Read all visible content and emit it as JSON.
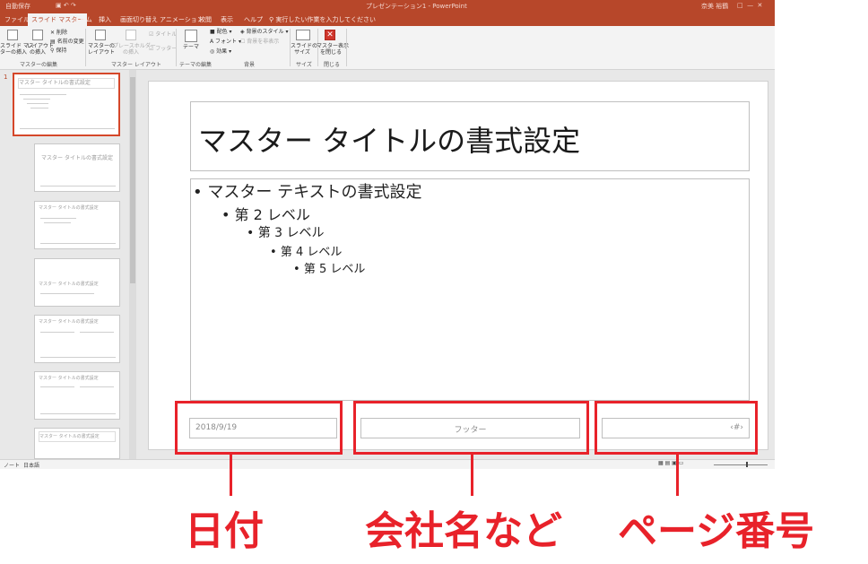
{
  "titlebar": {
    "autosave": "自動保存",
    "doc_title": "プレゼンテーション1 - PowerPoint",
    "user": "奈美 裕鶴"
  },
  "tabs": [
    {
      "label": "ファイル"
    },
    {
      "label": "スライド マスター"
    },
    {
      "label": "ホーム"
    },
    {
      "label": "挿入"
    },
    {
      "label": "画面切り替え"
    },
    {
      "label": "アニメーション"
    },
    {
      "label": "校閲"
    },
    {
      "label": "表示"
    },
    {
      "label": "ヘルプ"
    },
    {
      "label": "実行したい作業を入力してください"
    }
  ],
  "ribbon": {
    "insert_master": "スライド マス\nターの挿入",
    "insert_layout": "レイアウト\nの挿入",
    "delete": "削除",
    "rename": "名前の変更",
    "preserve": "保持",
    "master_layout": "マスターの\nレイアウト",
    "insert_placeholder": "プレースホルダー\nの挿入",
    "title_check": "タイトル",
    "footer_check": "フッター",
    "theme": "テーマ",
    "colors": "配色",
    "fonts": "フォント",
    "effects": "効果",
    "bg_styles": "背景のスタイル",
    "hide_bg": "背景を非表示",
    "slide_size": "スライドの\nサイズ",
    "close_master": "マスター表示\nを閉じる",
    "groups": {
      "edit_master": "マスターの編集",
      "master_layout": "マスター レイアウト",
      "edit_theme": "テーマの編集",
      "background": "背景",
      "size": "サイズ",
      "close": "閉じる"
    }
  },
  "thumbnails": {
    "slide_number": "1",
    "master_title": "マスター タイトルの書式設定",
    "layout_title": "マスター タイトルの書式設定"
  },
  "slide": {
    "title": "マスター タイトルの書式設定",
    "bullets": [
      {
        "text": "マスター テキストの書式設定",
        "level": 1
      },
      {
        "text": "第 2 レベル",
        "level": 2
      },
      {
        "text": "第 3 レベル",
        "level": 3
      },
      {
        "text": "第 4 レベル",
        "level": 4
      },
      {
        "text": "第 5 レベル",
        "level": 5
      }
    ],
    "date": "2018/9/19",
    "footer": "フッター",
    "page_number": "‹#›"
  },
  "statusbar": {
    "view": "ノート",
    "language": "日本語"
  },
  "annotations": {
    "date": "日付",
    "company": "会社名など",
    "page": "ページ番号"
  },
  "colors": {
    "accent": "#b7472a",
    "highlight": "#e8222a"
  }
}
